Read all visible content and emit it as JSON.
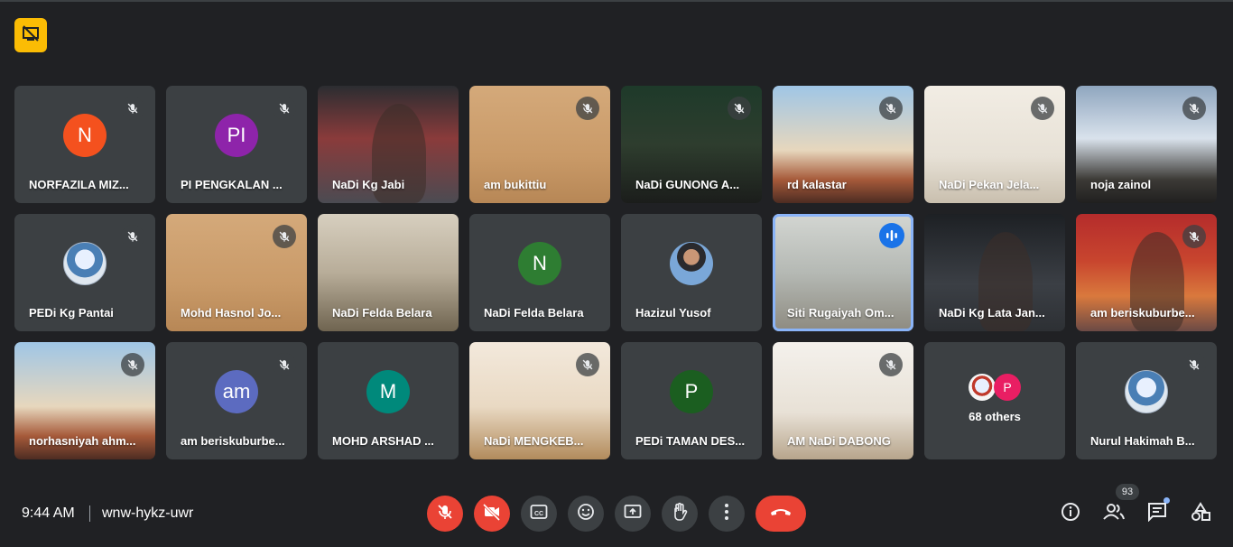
{
  "meeting": {
    "time": "9:44 AM",
    "code": "wnw-hykz-uwr"
  },
  "participants": [
    {
      "name": "NORFAZILA MIZ...",
      "initial": "N",
      "avatar_color": "#f4511e",
      "bg": "",
      "muted": true
    },
    {
      "name": "PI PENGKALAN ...",
      "initial": "PI",
      "avatar_color": "#8e24aa",
      "bg": "",
      "muted": true
    },
    {
      "name": "NaDi Kg Jabi",
      "initial": "",
      "avatar_color": "",
      "bg": "bg-teacher",
      "muted": false
    },
    {
      "name": "am bukittiu",
      "initial": "",
      "avatar_color": "",
      "bg": "bg-wood",
      "muted": true
    },
    {
      "name": "NaDi GUNONG A...",
      "initial": "",
      "avatar_color": "",
      "bg": "bg-office",
      "muted": true
    },
    {
      "name": "rd kalastar",
      "initial": "",
      "avatar_color": "",
      "bg": "bg-taj",
      "muted": true
    },
    {
      "name": "NaDi Pekan Jela...",
      "initial": "",
      "avatar_color": "",
      "bg": "bg-shelf",
      "muted": true
    },
    {
      "name": "noja zainol",
      "initial": "",
      "avatar_color": "",
      "bg": "bg-snow",
      "muted": true
    },
    {
      "name": "PEDi Kg Pantai",
      "initial": "",
      "avatar_color": "",
      "bg": "",
      "logo": true,
      "muted": true
    },
    {
      "name": "Mohd Hasnol Jo...",
      "initial": "",
      "avatar_color": "",
      "bg": "bg-wood",
      "muted": true
    },
    {
      "name": "NaDi Felda Belara",
      "initial": "",
      "avatar_color": "",
      "bg": "bg-street",
      "muted": false
    },
    {
      "name": "NaDi Felda Belara",
      "initial": "N",
      "avatar_color": "#2e7d32",
      "bg": "",
      "muted": false
    },
    {
      "name": "Hazizul Yusof",
      "initial": "",
      "avatar_color": "",
      "bg": "",
      "photo": true,
      "muted": false
    },
    {
      "name": "Siti Rugaiyah Om...",
      "initial": "",
      "avatar_color": "",
      "bg": "bg-window",
      "muted": false,
      "speaking": true
    },
    {
      "name": "NaDi Kg Lata Jan...",
      "initial": "",
      "avatar_color": "",
      "bg": "bg-dark",
      "muted": false
    },
    {
      "name": "am beriskuburbe...",
      "initial": "",
      "avatar_color": "",
      "bg": "bg-flag",
      "muted": true
    },
    {
      "name": "norhasniyah ahm...",
      "initial": "",
      "avatar_color": "",
      "bg": "bg-taj",
      "muted": true
    },
    {
      "name": "am beriskuburbe...",
      "initial": "am",
      "avatar_color": "#5c6bc0",
      "bg": "",
      "muted": true
    },
    {
      "name": "MOHD ARSHAD ...",
      "initial": "M",
      "avatar_color": "#00897b",
      "bg": "",
      "muted": false
    },
    {
      "name": "NaDi MENGKEB...",
      "initial": "",
      "avatar_color": "",
      "bg": "bg-gallery",
      "muted": true
    },
    {
      "name": "PEDi TAMAN DES...",
      "initial": "P",
      "avatar_color": "#1b5e20",
      "bg": "",
      "muted": false
    },
    {
      "name": "AM NaDi DABONG",
      "initial": "",
      "avatar_color": "",
      "bg": "bg-minimal",
      "muted": true
    },
    {
      "name": "68 others",
      "others": true,
      "stack_initial": "P",
      "stack_color": "#e91e63"
    },
    {
      "name": "Nurul Hakimah B...",
      "initial": "",
      "avatar_color": "",
      "bg": "",
      "logo": true,
      "muted": true
    }
  ],
  "controls": {
    "participants_count": "93"
  },
  "icons": {
    "warning": "presentation-blocked-icon",
    "mic_off": "mic-off-icon",
    "cam_off": "videocam-off-icon",
    "captions": "captions-icon",
    "emoji": "emoji-icon",
    "present": "present-screen-icon",
    "hand": "raise-hand-icon",
    "more": "more-vert-icon",
    "hangup": "call-end-icon",
    "info": "info-icon",
    "people": "people-icon",
    "chat": "chat-icon",
    "activities": "activities-icon"
  },
  "colors": {
    "speaking_outline": "#8ab4f8",
    "danger": "#ea4335",
    "warning": "#fbbc04"
  }
}
